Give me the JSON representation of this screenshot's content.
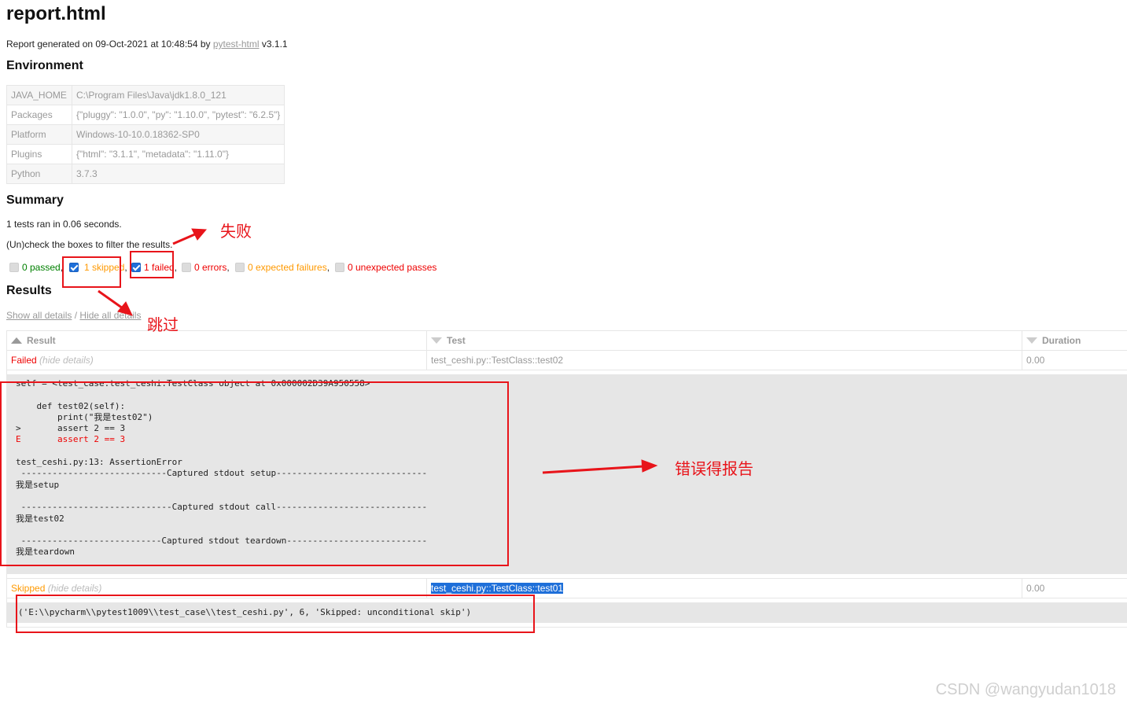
{
  "title": "report.html",
  "generated": {
    "prefix": "Report generated on 09-Oct-2021 at 10:48:54 by ",
    "link": "pytest-html",
    "suffix": " v3.1.1"
  },
  "environment": {
    "heading": "Environment",
    "rows": [
      {
        "key": "JAVA_HOME",
        "value": "C:\\Program Files\\Java\\jdk1.8.0_121"
      },
      {
        "key": "Packages",
        "value": "{\"pluggy\": \"1.0.0\", \"py\": \"1.10.0\", \"pytest\": \"6.2.5\"}"
      },
      {
        "key": "Platform",
        "value": "Windows-10-10.0.18362-SP0"
      },
      {
        "key": "Plugins",
        "value": "{\"html\": \"3.1.1\", \"metadata\": \"1.11.0\"}"
      },
      {
        "key": "Python",
        "value": "3.7.3"
      }
    ]
  },
  "summary": {
    "heading": "Summary",
    "ran": "1 tests ran in 0.06 seconds.",
    "hint": "(Un)check the boxes to filter the results.",
    "filters": {
      "passed": "0 passed",
      "skipped": "1 skipped",
      "failed": "1 failed",
      "errors": "0 errors",
      "xfailed": "0 expected failures",
      "xpassed": "0 unexpected passes"
    }
  },
  "results": {
    "heading": "Results",
    "show_all": "Show all details",
    "sep": " / ",
    "hide_all": "Hide all details",
    "columns": {
      "result": "Result",
      "test": "Test",
      "duration": "Duration"
    },
    "rows": [
      {
        "result": "Failed",
        "toggle": "(hide details)",
        "test": "test_ceshi.py::TestClass::test02",
        "duration": "0.00",
        "log": {
          "l1": "self = <test_case.test_ceshi.TestClass object at 0x000002D39A950558>",
          "l2": "",
          "l3": "    def test02(self):",
          "l4": "        print(\"我是test02\")",
          "l5": ">       assert 2 == 3",
          "l6": "E       assert 2 == 3",
          "l7": "",
          "l8": "test_ceshi.py:13: AssertionError",
          "l9": " ----------------------------Captured stdout setup-----------------------------",
          "l10": "我是setup",
          "l11": "",
          "l12": " -----------------------------Captured stdout call-----------------------------",
          "l13": "我是test02",
          "l14": "",
          "l15": " ---------------------------Captured stdout teardown---------------------------",
          "l16": "我是teardown"
        }
      },
      {
        "result": "Skipped",
        "toggle": "(hide details)",
        "test": "test_ceshi.py::TestClass::test01",
        "duration": "0.00",
        "log": "('E:\\\\pycharm\\\\pytest1009\\\\test_case\\\\test_ceshi.py', 6, 'Skipped: unconditional skip')"
      }
    ]
  },
  "annotations": {
    "fail": "失败",
    "skip": "跳过",
    "report": "错误得报告"
  },
  "watermark": "CSDN @wangyudan1018",
  "colors": {
    "passed": "#008000",
    "skipped": "#ff9900",
    "failed": "#ee0000",
    "annotation": "#e8141a",
    "checkbox": "#1e6fd9"
  }
}
